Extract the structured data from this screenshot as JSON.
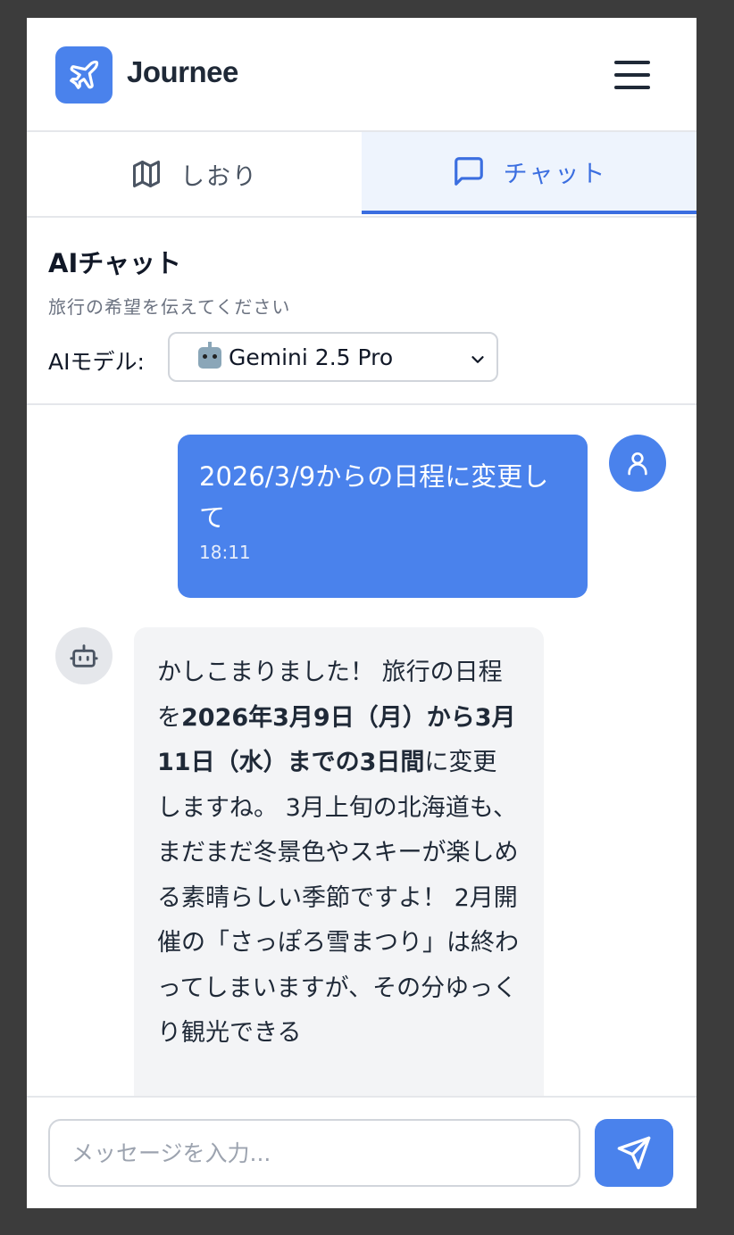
{
  "header": {
    "app_title": "Journee",
    "logo_icon": "airplane-icon",
    "menu_icon": "hamburger-menu-icon"
  },
  "tabs": [
    {
      "label": "しおり",
      "icon": "map-icon",
      "active": false
    },
    {
      "label": "チャット",
      "icon": "chat-bubble-icon",
      "active": true
    }
  ],
  "chat": {
    "title": "AIチャット",
    "subtitle": "旅行の希望を伝えてください",
    "model_label": "AIモデル:",
    "model_selected": "Gemini 2.5 Pro",
    "model_icon": "robot-emoji"
  },
  "messages": [
    {
      "role": "user",
      "text": "2026/3/9からの日程に変更して",
      "time": "18:11"
    },
    {
      "role": "assistant",
      "parts": [
        {
          "text": "かしこまりました！ 旅行の日程を",
          "bold": false
        },
        {
          "text": "2026年3月9日（月）から3月11日（水）までの3日間",
          "bold": true
        },
        {
          "text": "に変更しますね。 3月上旬の北海道も、まだまだ冬景色やスキーが楽しめる素晴らしい季節ですよ！ 2月開催の「さっぽろ雪まつり」は終わってしまいますが、その分ゆっくり観光できる",
          "bold": false
        }
      ]
    }
  ],
  "input": {
    "placeholder": "メッセージを入力...",
    "send_icon": "send-icon"
  },
  "colors": {
    "accent": "#4a82ec",
    "active_tab_text": "#3b6ee0",
    "active_tab_bg": "#eef4fd",
    "bot_bubble_bg": "#f3f4f6"
  }
}
